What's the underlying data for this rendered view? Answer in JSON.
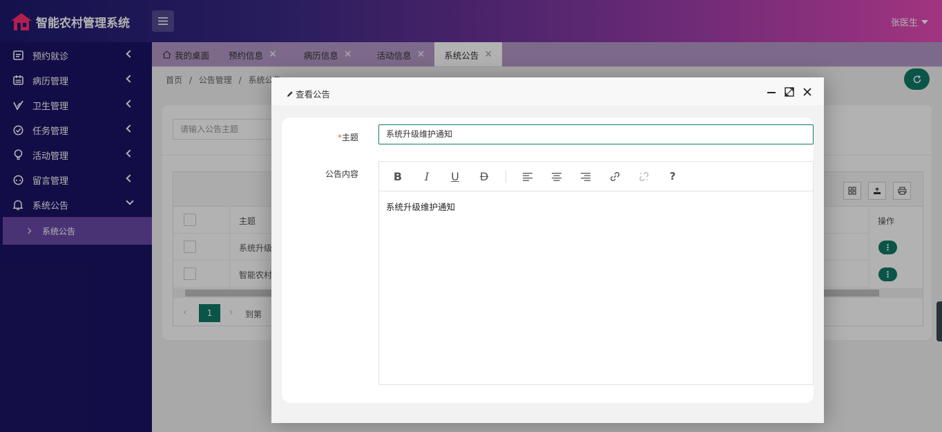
{
  "app": {
    "title": "智能农村管理系统",
    "user": "张医生"
  },
  "sidebar": {
    "items": [
      {
        "label": "预约就诊",
        "icon": "calendar-card-icon"
      },
      {
        "label": "病历管理",
        "icon": "calendar-grid-icon"
      },
      {
        "label": "卫生管理",
        "icon": "check-leaf-icon"
      },
      {
        "label": "任务管理",
        "icon": "circle-check-icon"
      },
      {
        "label": "活动管理",
        "icon": "lightbulb-icon"
      },
      {
        "label": "留言管理",
        "icon": "dial-icon"
      },
      {
        "label": "系统公告",
        "icon": "bell-icon"
      }
    ],
    "sub_item": "系统公告"
  },
  "tabs": [
    {
      "label": "我的桌面",
      "icon": "home-icon"
    },
    {
      "label": "预约信息"
    },
    {
      "label": "病历信息"
    },
    {
      "label": "活动信息"
    },
    {
      "label": "系统公告",
      "active": true
    }
  ],
  "breadcrumb": [
    "首页",
    "/",
    "公告管理",
    "/",
    "系统公告"
  ],
  "page": {
    "search_placeholder": "请输入公告主题",
    "col_subject": "主题",
    "col_action": "操作",
    "rows": [
      "系统升级",
      "智能农村"
    ],
    "current_page": "1",
    "goto_label": "到第"
  },
  "modal": {
    "title": "查看公告",
    "field_subject_required": "*",
    "field_subject_label": "主题",
    "field_subject_value": "系统升级维护通知",
    "field_content_label": "公告内容",
    "content_text": "系统升级维护通知",
    "toolbar": [
      "B",
      "I",
      "U",
      "D",
      "?"
    ]
  },
  "colors": {
    "accent": "#0f7a66",
    "sidebar": "#1c1466",
    "tabs": "#b399c8"
  }
}
